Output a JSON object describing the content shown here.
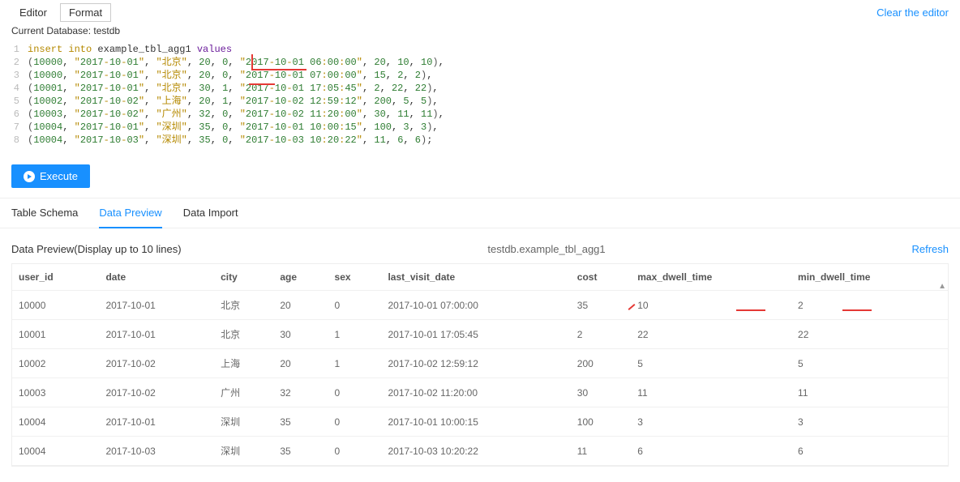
{
  "toolbar": {
    "editor": "Editor",
    "format": "Format",
    "clear": "Clear the editor"
  },
  "db_line": "Current Database: testdb",
  "code_lines": [
    {
      "n": 1,
      "kind": "head",
      "text": "insert into example_tbl_agg1 values"
    },
    {
      "n": 2,
      "kind": "row",
      "id": 10000,
      "date": "2017-10-01",
      "city": "北京",
      "age": 20,
      "sex": 0,
      "ts": "2017-10-01 06:00:00",
      "a": 20,
      "b": 10,
      "c": 10,
      "term": ","
    },
    {
      "n": 3,
      "kind": "row",
      "id": 10000,
      "date": "2017-10-01",
      "city": "北京",
      "age": 20,
      "sex": 0,
      "ts": "2017-10-01 07:00:00",
      "a": 15,
      "b": 2,
      "c": 2,
      "term": ","
    },
    {
      "n": 4,
      "kind": "row",
      "id": 10001,
      "date": "2017-10-01",
      "city": "北京",
      "age": 30,
      "sex": 1,
      "ts": "2017-10-01 17:05:45",
      "a": 2,
      "b": 22,
      "c": 22,
      "term": ","
    },
    {
      "n": 5,
      "kind": "row",
      "id": 10002,
      "date": "2017-10-02",
      "city": "上海",
      "age": 20,
      "sex": 1,
      "ts": "2017-10-02 12:59:12",
      "a": 200,
      "b": 5,
      "c": 5,
      "term": ","
    },
    {
      "n": 6,
      "kind": "row",
      "id": 10003,
      "date": "2017-10-02",
      "city": "广州",
      "age": 32,
      "sex": 0,
      "ts": "2017-10-02 11:20:00",
      "a": 30,
      "b": 11,
      "c": 11,
      "term": ","
    },
    {
      "n": 7,
      "kind": "row",
      "id": 10004,
      "date": "2017-10-01",
      "city": "深圳",
      "age": 35,
      "sex": 0,
      "ts": "2017-10-01 10:00:15",
      "a": 100,
      "b": 3,
      "c": 3,
      "term": ","
    },
    {
      "n": 8,
      "kind": "row",
      "id": 10004,
      "date": "2017-10-03",
      "city": "深圳",
      "age": 35,
      "sex": 0,
      "ts": "2017-10-03 10:20:22",
      "a": 11,
      "b": 6,
      "c": 6,
      "term": ";"
    }
  ],
  "execute": "Execute",
  "tabs": {
    "schema": "Table Schema",
    "preview": "Data Preview",
    "import_": "Data Import"
  },
  "preview": {
    "caption": "Data Preview(Display up to 10 lines)",
    "table_name": "testdb.example_tbl_agg1",
    "refresh": "Refresh"
  },
  "columns": [
    "user_id",
    "date",
    "city",
    "age",
    "sex",
    "last_visit_date",
    "cost",
    "max_dwell_time",
    "min_dwell_time"
  ],
  "rows": [
    [
      "10000",
      "2017-10-01",
      "北京",
      "20",
      "0",
      "2017-10-01 07:00:00",
      "35",
      "10",
      "2"
    ],
    [
      "10001",
      "2017-10-01",
      "北京",
      "30",
      "1",
      "2017-10-01 17:05:45",
      "2",
      "22",
      "22"
    ],
    [
      "10002",
      "2017-10-02",
      "上海",
      "20",
      "1",
      "2017-10-02 12:59:12",
      "200",
      "5",
      "5"
    ],
    [
      "10003",
      "2017-10-02",
      "广州",
      "32",
      "0",
      "2017-10-02 11:20:00",
      "30",
      "11",
      "11"
    ],
    [
      "10004",
      "2017-10-01",
      "深圳",
      "35",
      "0",
      "2017-10-01 10:00:15",
      "100",
      "3",
      "3"
    ],
    [
      "10004",
      "2017-10-03",
      "深圳",
      "35",
      "0",
      "2017-10-03 10:20:22",
      "11",
      "6",
      "6"
    ]
  ]
}
